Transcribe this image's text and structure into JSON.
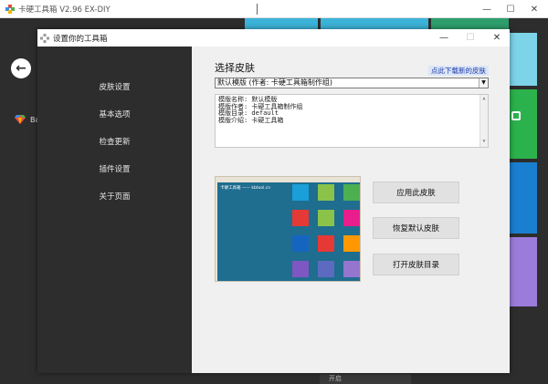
{
  "background_app": {
    "title": "卡硬工具箱 V2.96  EX-DIY",
    "sidebar_item_label": "Ba",
    "bottom_fragment": "开启"
  },
  "dialog": {
    "title": "设置你的工具箱",
    "nav": [
      "皮肤设置",
      "基本选项",
      "检查更新",
      "插件设置",
      "关于页面"
    ],
    "section_title": "选择皮肤",
    "download_link": "点此下载新的皮肤",
    "skin_select_value": "默认模版 (作者: 卡硬工具箱制作组)",
    "info_lines": [
      "模版名称: 默认模版",
      "模版作者: 卡硬工具箱制作组",
      "模版目录: default",
      "模版介绍: 卡硬工具箱"
    ],
    "preview_title": "卡硬工具箱 —— kbtool.cn",
    "buttons": {
      "apply": "应用此皮肤",
      "restore": "恢复默认皮肤",
      "open_dir": "打开皮肤目录"
    }
  },
  "colors": {
    "sidebar_bg": "#2d2d2d",
    "main_bg": "#f0f0f0",
    "link": "#1b3aa8",
    "preview_bg": "#1f6d8f"
  }
}
